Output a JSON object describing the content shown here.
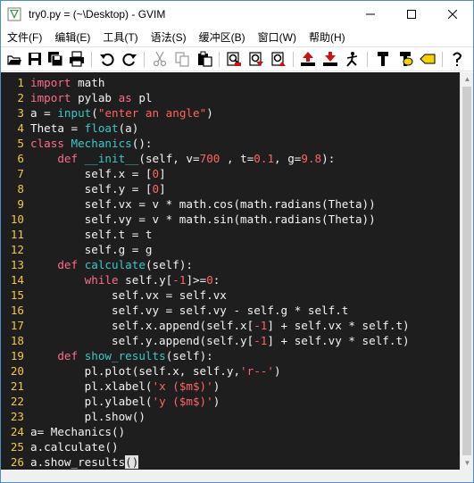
{
  "window": {
    "title": "try0.py = (~\\Desktop) - GVIM",
    "min_glyph": "—",
    "max_glyph": "☐",
    "close_glyph": "✕"
  },
  "menu": [
    "文件(F)",
    "编辑(E)",
    "工具(T)",
    "语法(S)",
    "缓冲区(B)",
    "窗口(W)",
    "帮助(H)"
  ],
  "toolbar": [
    "open-icon",
    "save-icon",
    "save-all-icon",
    "print-icon",
    "undo-icon",
    "redo-icon",
    "cut-icon",
    "copy-icon",
    "paste-icon",
    "find-replace-icon",
    "find-next-icon",
    "find-prev-icon",
    "load-session-icon",
    "save-session-icon",
    "run-script-icon",
    "make-icon",
    "shell-icon",
    "tag-jump-icon",
    "help-icon",
    "find-help-icon"
  ],
  "editor": {
    "lines": [
      {
        "num": "1",
        "tokens": [
          [
            "kw",
            "import"
          ],
          [
            "id",
            " math"
          ]
        ]
      },
      {
        "num": "2",
        "tokens": [
          [
            "kw",
            "import"
          ],
          [
            "id",
            " pylab "
          ],
          [
            "kw",
            "as"
          ],
          [
            "id",
            " pl"
          ]
        ]
      },
      {
        "num": "3",
        "tokens": [
          [
            "id",
            "a = "
          ],
          [
            "fn",
            "input"
          ],
          [
            "id",
            "("
          ],
          [
            "st",
            "\"enter an angle\""
          ],
          [
            "id",
            ")"
          ]
        ]
      },
      {
        "num": "4",
        "tokens": [
          [
            "id",
            "Theta = "
          ],
          [
            "fn",
            "float"
          ],
          [
            "id",
            "(a)"
          ]
        ]
      },
      {
        "num": "5",
        "tokens": [
          [
            "kw",
            "class"
          ],
          [
            "id",
            " "
          ],
          [
            "fn",
            "Mechanics"
          ],
          [
            "id",
            "():"
          ]
        ]
      },
      {
        "num": "6",
        "tokens": [
          [
            "id",
            "    "
          ],
          [
            "kw",
            "def"
          ],
          [
            "id",
            " "
          ],
          [
            "fn",
            "__init__"
          ],
          [
            "id",
            "(self, v="
          ],
          [
            "st",
            "700"
          ],
          [
            "id",
            " , t="
          ],
          [
            "st",
            "0.1"
          ],
          [
            "id",
            ", g="
          ],
          [
            "st",
            "9.8"
          ],
          [
            "id",
            "):"
          ]
        ]
      },
      {
        "num": "7",
        "tokens": [
          [
            "id",
            "        self.x = ["
          ],
          [
            "st",
            "0"
          ],
          [
            "id",
            "]"
          ]
        ]
      },
      {
        "num": "8",
        "tokens": [
          [
            "id",
            "        self.y = ["
          ],
          [
            "st",
            "0"
          ],
          [
            "id",
            "]"
          ]
        ]
      },
      {
        "num": "9",
        "tokens": [
          [
            "id",
            "        self.vx = v * math.cos(math.radians(Theta))"
          ]
        ]
      },
      {
        "num": "10",
        "tokens": [
          [
            "id",
            "        self.vy = v * math.sin(math.radians(Theta))"
          ]
        ]
      },
      {
        "num": "11",
        "tokens": [
          [
            "id",
            "        self.t = t"
          ]
        ]
      },
      {
        "num": "12",
        "tokens": [
          [
            "id",
            "        self.g = g"
          ]
        ]
      },
      {
        "num": "13",
        "tokens": [
          [
            "id",
            "    "
          ],
          [
            "kw",
            "def"
          ],
          [
            "id",
            " "
          ],
          [
            "fn",
            "calculate"
          ],
          [
            "id",
            "(self):"
          ]
        ]
      },
      {
        "num": "14",
        "tokens": [
          [
            "id",
            "        "
          ],
          [
            "kw",
            "while"
          ],
          [
            "id",
            " self.y["
          ],
          [
            "st",
            "-1"
          ],
          [
            "id",
            "]>="
          ],
          [
            "st",
            "0"
          ],
          [
            "id",
            ":"
          ]
        ]
      },
      {
        "num": "15",
        "tokens": [
          [
            "id",
            "            self.vx = self.vx"
          ]
        ]
      },
      {
        "num": "16",
        "tokens": [
          [
            "id",
            "            self.vy = self.vy - self.g * self.t"
          ]
        ]
      },
      {
        "num": "17",
        "tokens": [
          [
            "id",
            "            self.x.append(self.x["
          ],
          [
            "st",
            "-1"
          ],
          [
            "id",
            "] + self.vx * self.t)"
          ]
        ]
      },
      {
        "num": "18",
        "tokens": [
          [
            "id",
            "            self.y.append(self.y["
          ],
          [
            "st",
            "-1"
          ],
          [
            "id",
            "] + self.vy * self.t)"
          ]
        ]
      },
      {
        "num": "19",
        "tokens": [
          [
            "id",
            "    "
          ],
          [
            "kw",
            "def"
          ],
          [
            "id",
            " "
          ],
          [
            "fn",
            "show_results"
          ],
          [
            "id",
            "(self):"
          ]
        ]
      },
      {
        "num": "20",
        "tokens": [
          [
            "id",
            "        pl.plot(self.x, self.y,"
          ],
          [
            "st",
            "'r--'"
          ],
          [
            "id",
            ")"
          ]
        ]
      },
      {
        "num": "21",
        "tokens": [
          [
            "id",
            "        pl.xlabel("
          ],
          [
            "st",
            "'x ($m$)'"
          ],
          [
            "id",
            ")"
          ]
        ]
      },
      {
        "num": "22",
        "tokens": [
          [
            "id",
            "        pl.ylabel("
          ],
          [
            "st",
            "'y ($m$)'"
          ],
          [
            "id",
            ")"
          ]
        ]
      },
      {
        "num": "23",
        "tokens": [
          [
            "id",
            "        pl.show()"
          ]
        ]
      },
      {
        "num": "24",
        "tokens": [
          [
            "id",
            "a= Mechanics()"
          ]
        ]
      },
      {
        "num": "25",
        "tokens": [
          [
            "id",
            "a.calculate()"
          ]
        ]
      },
      {
        "num": "26",
        "tokens": [
          [
            "id",
            "a.show_results"
          ],
          [
            "cursor",
            "()"
          ]
        ]
      }
    ]
  },
  "scrollbar": {
    "up_glyph": "▲",
    "down_glyph": "▼"
  }
}
